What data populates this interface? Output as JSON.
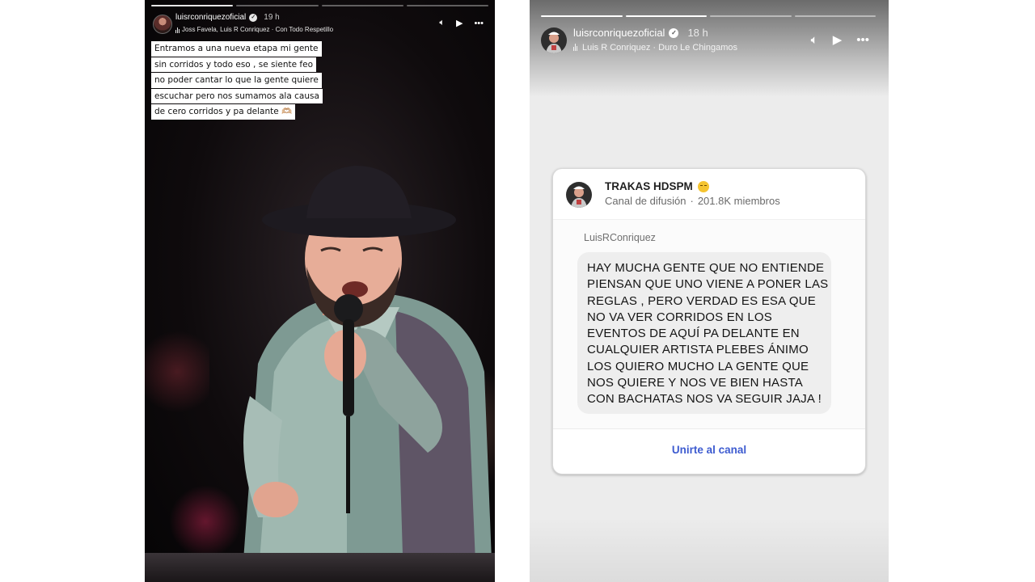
{
  "story_left": {
    "username": "luisrconriquezoficial",
    "time": "19 h",
    "music": "Joss Favela, Luis R Conriquez · Con Todo Respetillo",
    "caption_lines": [
      "Entramos a una nueva etapa mi gente",
      "sin corridos y todo eso , se siente feo",
      "no poder cantar lo que la gente quiere",
      "escuchar pero nos sumamos ala causa",
      "de cero corridos y pa delante 🫶🏼"
    ],
    "progress": {
      "segments": 4,
      "current": 1
    }
  },
  "story_right": {
    "username": "luisrconriquezoficial",
    "time": "18 h",
    "music": "Luis R Conriquez · Duro Le Chingamos",
    "progress": {
      "segments": 4,
      "current": 2
    },
    "card": {
      "channel_name": "TRAKAS HDSPM",
      "channel_type": "Canal de difusión",
      "members": "201.8K miembros",
      "sender": "LuisRConriquez",
      "message_lines": [
        "HAY MUCHA GENTE QUE NO ENTIENDE",
        "PIENSAN QUE UNO VIENE A PONER LAS",
        "REGLAS , PERO VERDAD ES ESA QUE",
        "NO VA VER CORRIDOS EN LOS",
        "EVENTOS DE AQUÍ PA DELANTE EN",
        "CUALQUIER ARTISTA PLEBES ÁNIMO",
        "LOS QUIERO MUCHO LA GENTE QUE",
        "NOS QUIERE Y NOS VE BIEN HASTA",
        "CON BACHATAS NOS VA SEGUIR JAJA !"
      ],
      "join_label": "Unirte al canal"
    }
  },
  "icons": [
    "volume-icon",
    "play-icon",
    "more-icon",
    "music-bars-icon",
    "verified-icon"
  ],
  "colors": {
    "join_link": "#3d5bd0",
    "bubble": "#eeeeee"
  }
}
